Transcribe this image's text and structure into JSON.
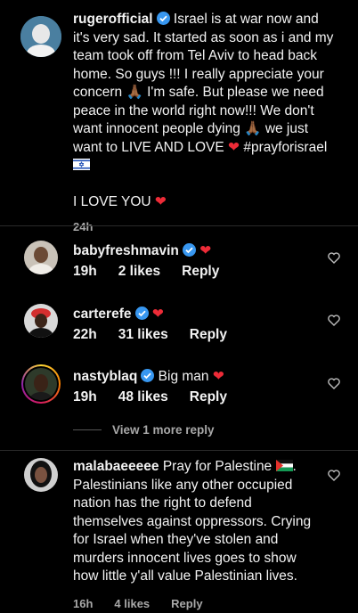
{
  "post": {
    "username": "rugerofficial",
    "lines": [
      "Israel is at war now and",
      "it's very sad. It started as soon as i and my",
      "team took off from Tel Aviv to head back",
      "home. So guys !!! I really appreciate your",
      "concern",
      "I'm safe. But please we need",
      "peace in the world right now!!! We don't",
      "want innocent people dying",
      "we just",
      "want to LIVE AND LOVE",
      "#prayforisrael",
      "I LOVE YOU"
    ],
    "time": "24h"
  },
  "comments": [
    {
      "username": "babyfreshmavin",
      "text": "",
      "time": "19h",
      "likes": "2 likes",
      "reply": "Reply"
    },
    {
      "username": "carterefe",
      "text": "",
      "time": "22h",
      "likes": "31 likes",
      "reply": "Reply"
    },
    {
      "username": "nastyblaq",
      "text": "Big man",
      "time": "19h",
      "likes": "48 likes",
      "reply": "Reply"
    }
  ],
  "view_more": "View 1 more reply",
  "last_comment": {
    "username": "malabaeeeee",
    "first": "Pray for Palestine",
    "lines": [
      "Palestinians like any other occupied",
      "nation has the right to defend",
      "themselves against oppressors. Crying",
      "for Israel when they've stolen and",
      "murders innocent lives goes to show",
      "how little y'all value Palestinian lives."
    ],
    "time": "16h",
    "likes": "4 likes",
    "reply": "Reply"
  },
  "colors": {
    "background": "#000000",
    "verified": "#3897f0",
    "heart": "#ed2b37",
    "meta": "#a8a8a8"
  }
}
